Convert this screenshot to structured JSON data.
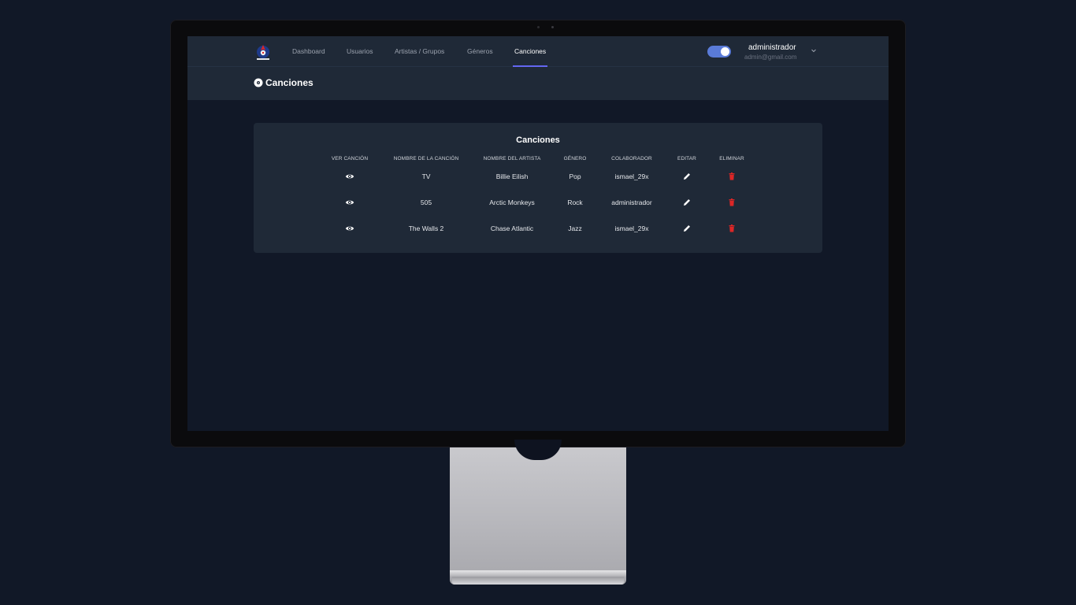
{
  "nav": {
    "items": [
      "Dashboard",
      "Usuarios",
      "Artistas / Grupos",
      "Géneros",
      "Canciones"
    ],
    "active": "Canciones"
  },
  "user": {
    "name": "administrador",
    "email": "admin@gmail.com",
    "theme_toggle": "on"
  },
  "page": {
    "title": "Canciones"
  },
  "table": {
    "title": "Canciones",
    "headers": [
      "Ver canción",
      "Nombre de la canción",
      "Nombre del artista",
      "Género",
      "Colaborador",
      "Editar",
      "Eliminar"
    ],
    "rows": [
      {
        "song": "TV",
        "artist": "Billie Eilish",
        "genre": "Pop",
        "collaborator": "ismael_29x"
      },
      {
        "song": "505",
        "artist": "Arctic Monkeys",
        "genre": "Rock",
        "collaborator": "administrador"
      },
      {
        "song": "The Walls 2",
        "artist": "Chase Atlantic",
        "genre": "Jazz",
        "collaborator": "ismael_29x"
      }
    ]
  },
  "icons": {
    "view": "eye-icon",
    "edit": "pencil-icon",
    "delete": "trash-icon",
    "header": "disc-icon"
  },
  "colors": {
    "accent": "#6366f1",
    "toggle": "#5a7bd8",
    "delete": "#dc2626",
    "card": "#1f2937",
    "background": "#111827"
  }
}
